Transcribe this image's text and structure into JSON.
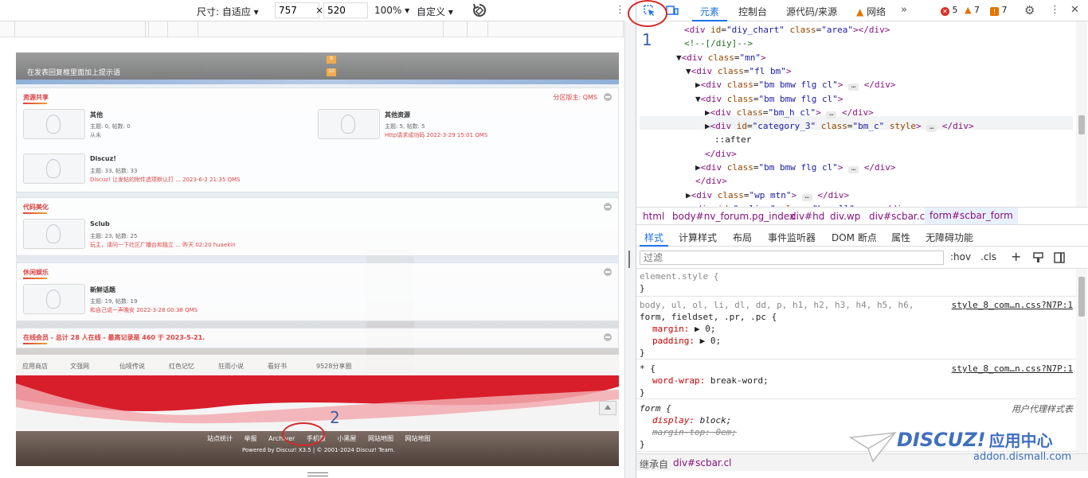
{
  "device_toolbar": {
    "size_label": "尺寸: 自适应",
    "width": "757",
    "height": "520",
    "zoom": "100%",
    "custom": "自定义",
    "times": "×"
  },
  "page": {
    "topbar_hint": "在发表回复框里面加上提示语",
    "badge1": "9",
    "badge2": "10",
    "sections": [
      {
        "title": "资源共享",
        "moderator": "分区版主: QMS",
        "forums": [
          {
            "name": "其他",
            "stats": "主题: 0, 帖数: 0",
            "last": "从未"
          },
          {
            "name": "其他资源",
            "stats": "主题: 5, 帖数: 5",
            "last": "Http请求成功码 2022-3-29 15:01 QMS"
          },
          {
            "name": "Discuz!",
            "stats": "主题: 33, 帖数: 33",
            "last": "Discuz! 让发帖的附件选项默认打 ... 2023-6-2 21:35 QMS"
          }
        ]
      },
      {
        "title": "代码美化",
        "forums": [
          {
            "name": "Sclub",
            "stats": "主题: 23, 帖数: 25",
            "last": "玩主，请问一下社区广播台和独立 ... 昨天 02:20 huaekin"
          }
        ]
      },
      {
        "title": "休闲娱乐",
        "forums": [
          {
            "name": "新鲜话题",
            "stats": "主题: 19, 帖数: 19",
            "last": "和自己说一声晚安 2022-3-28 00:38 QMS"
          }
        ]
      },
      {
        "title": "在线会员 - 总计 28 人在线 - 最高记录是 460 于 2023-5-21."
      }
    ],
    "friend_links": [
      "应用商店",
      "文强网",
      "仙境传说",
      "红色记忆",
      "狂雨小说",
      "看好书",
      "9528分享圈"
    ],
    "footer_links": [
      "站点统计",
      "举报",
      "Archiver",
      "手机版",
      "小黑屋",
      "网站地图",
      "网站地图"
    ],
    "powered": "Powered by Discuz! X3.5 | © 2001-2024 Discuz! Team."
  },
  "annotations": {
    "one": "1",
    "two": "2"
  },
  "devtools": {
    "tabs": [
      "元素",
      "控制台",
      "源代码/来源",
      "网络"
    ],
    "errors": "5",
    "warnings": "7",
    "issues": "7",
    "dom": [
      {
        "indent": 60,
        "html": "<span class='tag'>&lt;div</span> <span class='attr'>id</span>=<span class='val'>\"diy_chart\"</span> <span class='attr'>class</span>=<span class='val'>\"area\"</span><span class='tag'>&gt;&lt;/div&gt;</span>"
      },
      {
        "indent": 60,
        "html": "<span class='cmt'>&lt;!--[/diy]--&gt;</span>"
      },
      {
        "indent": 50,
        "html": "▼<span class='tag'>&lt;div</span> <span class='attr'>class</span>=<span class='val'>\"mn\"</span><span class='tag'>&gt;</span>"
      },
      {
        "indent": 62,
        "html": "▼<span class='tag'>&lt;div</span> <span class='attr'>class</span>=<span class='val'>\"fl bm\"</span><span class='tag'>&gt;</span>"
      },
      {
        "indent": 74,
        "html": "▶<span class='tag'>&lt;div</span> <span class='attr'>class</span>=<span class='val'>\"bm bmw  flg cl\"</span><span class='tag'>&gt;</span> <span class='ell'>…</span> <span class='tag'>&lt;/div&gt;</span>"
      },
      {
        "indent": 74,
        "html": "▼<span class='tag'>&lt;div</span> <span class='attr'>class</span>=<span class='val'>\"bm bmw  flg cl\"</span><span class='tag'>&gt;</span>"
      },
      {
        "indent": 86,
        "html": "▶<span class='tag'>&lt;div</span> <span class='attr'>class</span>=<span class='val'>\"bm_h cl\"</span><span class='tag'>&gt;</span> <span class='ell'>…</span> <span class='tag'>&lt;/div&gt;</span>"
      },
      {
        "indent": 86,
        "html": "▶<span class='tag'>&lt;div</span> <span class='attr'>id</span>=<span class='val'>\"category_3\"</span> <span class='attr'>class</span>=<span class='val'>\"bm_c\"</span> <span class='attr'>style</span><span class='tag'>&gt;</span> <span class='ell'>…</span> <span class='tag'>&lt;/div&gt;</span>"
      },
      {
        "indent": 98,
        "html": "::after"
      },
      {
        "indent": 86,
        "html": "<span class='tag'>&lt;/div&gt;</span>"
      },
      {
        "indent": 74,
        "html": "▶<span class='tag'>&lt;div</span> <span class='attr'>class</span>=<span class='val'>\"bm bmw  flg cl\"</span><span class='tag'>&gt;</span> <span class='ell'>…</span> <span class='tag'>&lt;/div&gt;</span>"
      },
      {
        "indent": 74,
        "html": "<span class='tag'>&lt;/div&gt;</span>"
      },
      {
        "indent": 62,
        "html": "▶<span class='tag'>&lt;div</span> <span class='attr'>class</span>=<span class='val'>\"wp mtn\"</span><span class='tag'>&gt;</span> <span class='ell'>…</span> <span class='tag'>&lt;/div&gt;</span>"
      },
      {
        "indent": 62,
        "html": "▶<span class='tag'>&lt;div</span> <span class='attr'>id</span>=<span class='val'>\"online\"</span> <span class='attr'>class</span>=<span class='val'>\"bm oll\"</span><span class='tag'>&gt;</span> <span class='ell'>…</span> <span class='tag'>&lt;/div&gt;</span>"
      }
    ],
    "crumbs": [
      "html",
      "body#nv_forum.pg_index",
      "div#hd",
      "div.wp",
      "div#scbar.cl",
      "form#scbar_form"
    ],
    "subtabs": [
      "样式",
      "计算样式",
      "布局",
      "事件监听器",
      "DOM 断点",
      "属性",
      "无障碍功能"
    ],
    "filter_placeholder": "过滤",
    "hov": ":hov",
    "cls": ".cls",
    "rules": {
      "element_style": "element.style {",
      "rule2_sel1": "body, ul, ol, li, dl, dd, p, h1, h2, h3, h4, h5, h6,",
      "rule2_sel2": "form, fieldset, .pr, .pc {",
      "rule2_src": "style_8_com…n.css?N7P:1",
      "rule2_p1": "margin:",
      "rule2_v1": "▶ 0;",
      "rule2_p2": "padding:",
      "rule2_v2": "▶ 0;",
      "rule3_sel": "* {",
      "rule3_src": "style_8_com…n.css?N7P:1",
      "rule3_p": "word-wrap:",
      "rule3_v": "break-word;",
      "rule4_sel": "form {",
      "rule4_src": "用户代理样式表",
      "rule4_p1": "display:",
      "rule4_v1": "block;",
      "rule4_p2": "margin-top:",
      "rule4_v2": "0em;",
      "close": "}"
    },
    "inherited_label": "继承自",
    "inherited_from": "div#scbar.cl"
  },
  "watermark": {
    "logo": "DISCUZ!",
    "title": "应用中心",
    "url": "addon.dismall.com"
  },
  "colors": {
    "accent": "#1a73e8",
    "annotation_red": "#d42a2a",
    "annotation_blue": "#3b5fa8"
  }
}
